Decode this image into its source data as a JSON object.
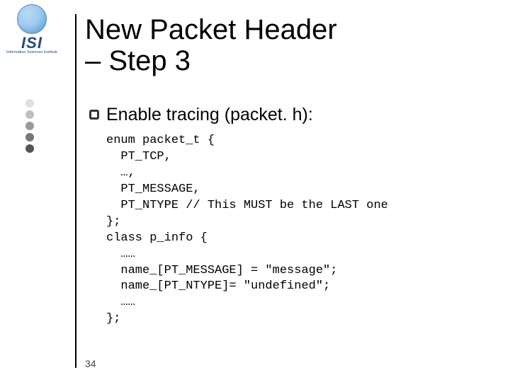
{
  "logo": {
    "abbrev": "ISI",
    "subline": "Information Sciences Institute"
  },
  "title_line1": "New Packet Header",
  "title_line2": "– Step 3",
  "bullet_text": "Enable tracing (packet. h):",
  "code": {
    "l1": "enum packet_t {",
    "l2": "  PT_TCP,",
    "l3": "  …,",
    "l4": "  PT_MESSAGE,",
    "l5": "  PT_NTYPE // This MUST be the LAST one",
    "l6": "};",
    "l7": "class p_info {",
    "l8": "  ……",
    "l9": "  name_[PT_MESSAGE] = \"message\";",
    "l10": "  name_[PT_NTYPE]= \"undefined\";",
    "l11": "  ……",
    "l12": "};"
  },
  "page_number": "34"
}
